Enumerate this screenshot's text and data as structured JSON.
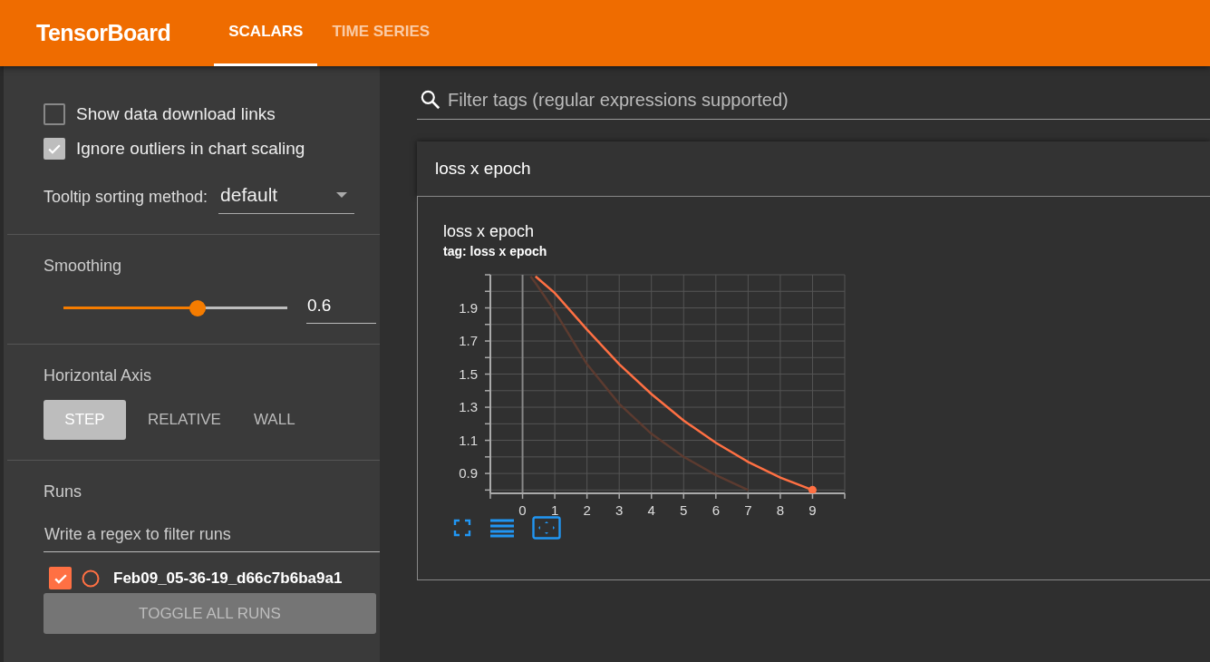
{
  "header": {
    "title": "TensorBoard",
    "tabs": [
      {
        "label": "SCALARS",
        "selected": true
      },
      {
        "label": "TIME SERIES",
        "selected": false
      }
    ]
  },
  "sidebar": {
    "options": [
      {
        "label": "Show data download links",
        "checked": false
      },
      {
        "label": "Ignore outliers in chart scaling",
        "checked": true
      }
    ],
    "tooltip_sorting": {
      "label": "Tooltip sorting method:",
      "value": "default"
    },
    "smoothing": {
      "label": "Smoothing",
      "level": 0.6,
      "value": "0.6"
    },
    "horizontal_axis": {
      "label": "Horizontal Axis",
      "options": [
        {
          "label": "STEP",
          "selected": true
        },
        {
          "label": "RELATIVE",
          "selected": false
        },
        {
          "label": "WALL",
          "selected": false
        }
      ]
    },
    "runs": {
      "label": "Runs",
      "filter_placeholder": "Write a regex to filter runs",
      "items": [
        {
          "name": "Feb09_05-36-19_d66c7b6ba9a1",
          "checked": true,
          "color": "#ff7043"
        }
      ],
      "toggle_button": "TOGGLE ALL RUNS"
    }
  },
  "main": {
    "filter_placeholder": "Filter tags (regular expressions supported)",
    "category": {
      "title": "loss x epoch",
      "cards": [
        {
          "title": "loss x epoch",
          "tag": "tag: loss x epoch",
          "chart_data": {
            "type": "line",
            "grid": true,
            "x": [
              0.25,
              0.4,
              1,
              2,
              3,
              4,
              5,
              6,
              7,
              8,
              9
            ],
            "xlim": [
              -1,
              10
            ],
            "ylim": [
              0.78,
              2.1
            ],
            "xticks": [
              0,
              1,
              2,
              3,
              4,
              5,
              6,
              7,
              8,
              9
            ],
            "yticks": [
              0.9,
              1.1,
              1.3,
              1.5,
              1.7,
              1.9
            ],
            "series": [
              {
                "color": "#5c3b30",
                "values": [
                  2.09,
                  2.05,
                  1.88,
                  1.56,
                  1.32,
                  1.14,
                  1.0,
                  0.89,
                  0.8,
                  null,
                  null
                ]
              },
              {
                "color": "#ff7043",
                "values": [
                  null,
                  2.09,
                  1.99,
                  1.77,
                  1.56,
                  1.38,
                  1.22,
                  1.085,
                  0.97,
                  0.875,
                  0.8
                ]
              }
            ]
          }
        }
      ]
    }
  }
}
